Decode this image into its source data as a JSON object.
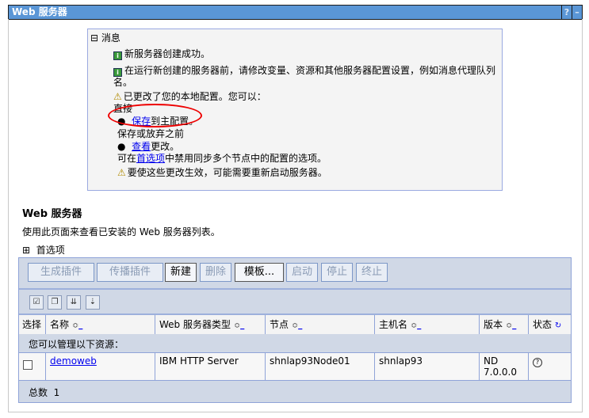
{
  "title": "Web 服务器",
  "title_buttons": {
    "help": "?",
    "minimize": "–"
  },
  "messages": {
    "header": "消息",
    "toggle": "⊟",
    "items": [
      "新服务器创建成功。",
      "在运行新创建的服务器前，请修改变量、资源和其他服务器配置设置，例如消息代理队列",
      "名。",
      "已更改了您的本地配置。您可以："
    ],
    "direct": "直接",
    "save_link": "保存",
    "save_rest": "到主配置。",
    "before": "保存或放弃之前",
    "review_link": "查看",
    "review_rest": "更改。",
    "pref_prefix": "可在",
    "pref_link": "首选项",
    "pref_rest": "中禁用同步多个节点中的配置的选项。",
    "restart": "要使这些更改生效，可能需要重新启动服务器。"
  },
  "section": {
    "title": "Web 服务器",
    "description": "使用此页面来查看已安装的 Web 服务器列表。",
    "preferences": "首选项",
    "pref_toggle": "⊞"
  },
  "buttons": [
    "生成插件",
    "传播插件",
    "新建",
    "删除",
    "模板...",
    "启动",
    "停止",
    "终止"
  ],
  "columns": [
    "选择",
    "名称",
    "Web 服务器类型",
    "节点",
    "主机名",
    "版本",
    "状态"
  ],
  "manage_text": "您可以管理以下资源：",
  "rows": [
    {
      "name": "demoweb",
      "type": "IBM HTTP Server",
      "node": "shnlap93Node01",
      "host": "shnlap93",
      "version_1": "ND",
      "version_2": "7.0.0.0",
      "status": "?"
    }
  ],
  "total_label": "总数",
  "total": "1"
}
